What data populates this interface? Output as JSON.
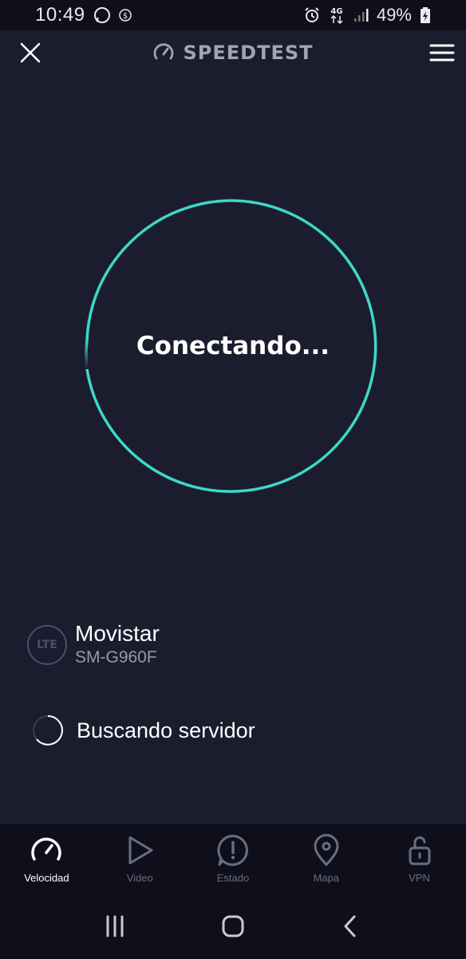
{
  "status_bar": {
    "time": "10:49",
    "network": "4G",
    "battery": "49%"
  },
  "header": {
    "title": "SPEEDTEST"
  },
  "main": {
    "connect_label": "Conectando...",
    "accent_color": "#3dd8c8"
  },
  "provider": {
    "badge": "LTE",
    "name": "Movistar",
    "device": "SM-G960F"
  },
  "server": {
    "status": "Buscando servidor"
  },
  "nav": {
    "items": [
      {
        "label": "Velocidad",
        "icon": "speedometer-icon",
        "active": true
      },
      {
        "label": "Video",
        "icon": "play-icon",
        "active": false
      },
      {
        "label": "Estado",
        "icon": "alert-icon",
        "active": false
      },
      {
        "label": "Mapa",
        "icon": "map-pin-icon",
        "active": false
      },
      {
        "label": "VPN",
        "icon": "unlock-icon",
        "active": false
      }
    ]
  }
}
